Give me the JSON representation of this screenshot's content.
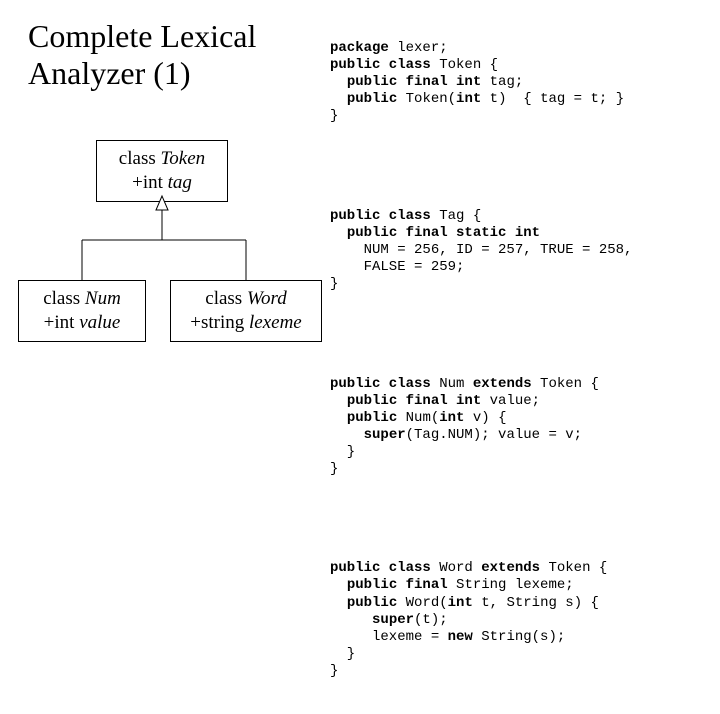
{
  "title": "Complete Lexical Analyzer (1)",
  "uml": {
    "token": {
      "class_kw": "class",
      "class_name": "Token",
      "field_prefix": "+",
      "field_type": "int",
      "field_name": "tag"
    },
    "num": {
      "class_kw": "class",
      "class_name": "Num",
      "field_prefix": "+",
      "field_type": "int",
      "field_name": "value"
    },
    "word": {
      "class_kw": "class",
      "class_name": "Word",
      "field_prefix": "+",
      "field_type": "string",
      "field_name": "lexeme"
    }
  },
  "code": {
    "block1_html": "<span class=\"kw\">package</span> lexer;\n<span class=\"kw\">public class</span> Token {\n  <span class=\"kw\">public final int</span> tag;\n  <span class=\"kw\">public</span> Token(<span class=\"kw\">int</span> t)  { tag = t; }\n}",
    "block2_html": "<span class=\"kw\">public class</span> Tag {\n  <span class=\"kw\">public final static int</span>\n    NUM = 256, ID = 257, TRUE = 258,\n    FALSE = 259;\n}",
    "block3_html": "<span class=\"kw\">public class</span> Num <span class=\"kw\">extends</span> Token {\n  <span class=\"kw\">public final int</span> value;\n  <span class=\"kw\">public</span> Num(<span class=\"kw\">int</span> v) {\n    <span class=\"kw\">super</span>(Tag.NUM); value = v;\n  }\n}",
    "block4_html": "<span class=\"kw\">public class</span> Word <span class=\"kw\">extends</span> Token {\n  <span class=\"kw\">public final</span> String lexeme;\n  <span class=\"kw\">public</span> Word(<span class=\"kw\">int</span> t, String s) {\n     <span class=\"kw\">super</span>(t);\n     lexeme = <span class=\"kw\">new</span> String(s);\n  }\n}"
  }
}
